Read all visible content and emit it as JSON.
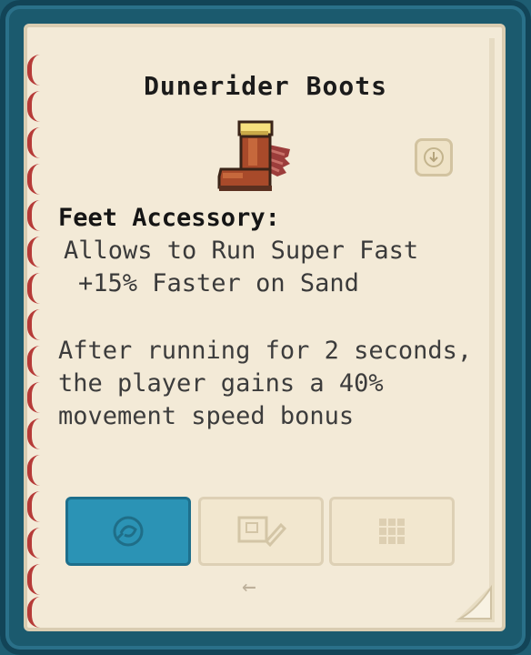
{
  "item": {
    "title": "Dunerider Boots",
    "category": "Feet Accessory:",
    "stats": [
      "Allows to Run Super Fast",
      "+15% Faster on Sand"
    ],
    "description": "After running for 2 seconds,\nthe player gains a 40%\nmovement speed bonus"
  },
  "icons": {
    "item": "dunerider-boots-icon",
    "download": "down-arrow-icon",
    "tab1": "swirl-icon",
    "tab2": "map-pencil-icon",
    "tab3": "grid-icon",
    "back": "left-arrow-icon",
    "corner": "page-curl-icon"
  },
  "back_label": "←"
}
